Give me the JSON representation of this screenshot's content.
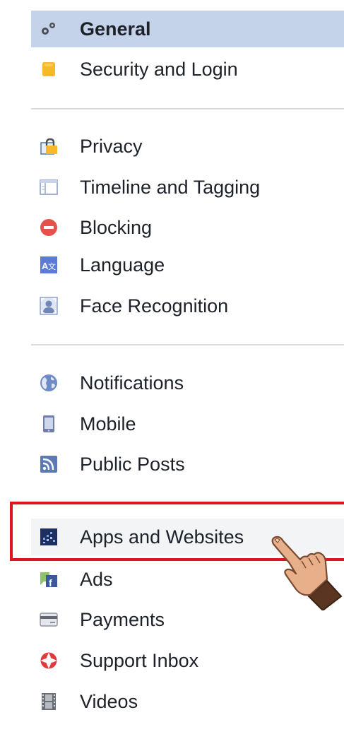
{
  "sidebar": {
    "items": [
      {
        "label": "General",
        "icon": "gears-icon"
      },
      {
        "label": "Security and Login",
        "icon": "shield-icon"
      },
      {
        "label": "Privacy",
        "icon": "lock-icon"
      },
      {
        "label": "Timeline and Tagging",
        "icon": "timeline-icon"
      },
      {
        "label": "Blocking",
        "icon": "blocking-icon"
      },
      {
        "label": "Language",
        "icon": "language-icon"
      },
      {
        "label": "Face Recognition",
        "icon": "face-recognition-icon"
      },
      {
        "label": "Notifications",
        "icon": "globe-icon"
      },
      {
        "label": "Mobile",
        "icon": "mobile-icon"
      },
      {
        "label": "Public Posts",
        "icon": "rss-icon"
      },
      {
        "label": "Apps and Websites",
        "icon": "apps-icon"
      },
      {
        "label": "Ads",
        "icon": "ads-icon"
      },
      {
        "label": "Payments",
        "icon": "credit-card-icon"
      },
      {
        "label": "Support Inbox",
        "icon": "lifebuoy-icon"
      },
      {
        "label": "Videos",
        "icon": "film-icon"
      }
    ]
  },
  "colors": {
    "active_bg": "#c5d3ea",
    "highlight_border": "#e0141e",
    "divider": "#d8dadf",
    "text": "#1d2129"
  }
}
